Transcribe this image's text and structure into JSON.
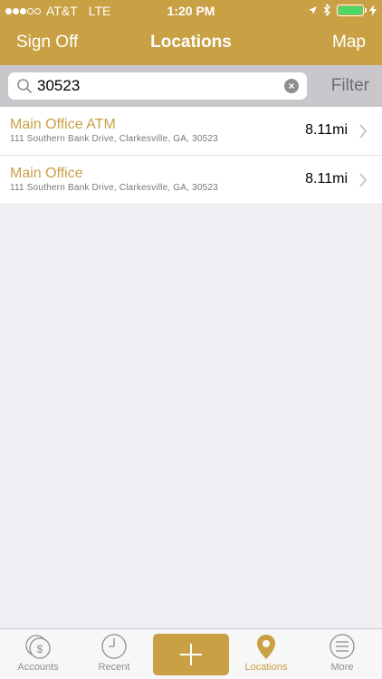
{
  "status": {
    "carrier": "AT&T",
    "network": "LTE",
    "time": "1:20 PM"
  },
  "nav": {
    "left": "Sign Off",
    "title": "Locations",
    "right": "Map"
  },
  "search": {
    "value": "30523",
    "filter_label": "Filter"
  },
  "locations": [
    {
      "name": "Main Office ATM",
      "address": "111 Southern Bank Drive, Clarkesville, GA, 30523",
      "distance": "8.11mi"
    },
    {
      "name": "Main Office",
      "address": "111 Southern Bank Drive, Clarkesville, GA, 30523",
      "distance": "8.11mi"
    }
  ],
  "tabs": [
    {
      "label": "Accounts",
      "icon": "dollar-coin-icon"
    },
    {
      "label": "Recent",
      "icon": "clock-icon"
    },
    {
      "label": "",
      "icon": "plus-icon"
    },
    {
      "label": "Locations",
      "icon": "map-pin-icon",
      "active": true
    },
    {
      "label": "More",
      "icon": "menu-icon"
    }
  ],
  "colors": {
    "accent": "#c9a044",
    "background": "#efeff4",
    "battery": "#4cd964"
  }
}
